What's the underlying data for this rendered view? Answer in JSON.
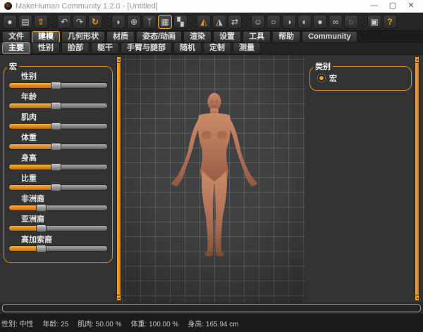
{
  "window": {
    "title": "MakeHuman Community 1.2.0 - [Untitled]",
    "controls": {
      "minimize": "—",
      "maximize": "▢",
      "close": "✕"
    }
  },
  "toolbar": {
    "buttons": [
      {
        "name": "new-human-icon",
        "glyph": "●"
      },
      {
        "name": "load-file-icon",
        "glyph": "▤"
      },
      {
        "name": "save-file-icon",
        "glyph": "⇧",
        "accent": true
      },
      {
        "sep": true
      },
      {
        "name": "undo-icon",
        "glyph": "↶"
      },
      {
        "name": "redo-icon",
        "glyph": "↷"
      },
      {
        "name": "reset-camera-icon",
        "glyph": "↻",
        "accent": true
      },
      {
        "sep": true
      },
      {
        "name": "smooth-shading-icon",
        "glyph": "◗"
      },
      {
        "name": "wireframe-icon",
        "glyph": "⊕"
      },
      {
        "name": "skeleton-icon",
        "glyph": "ᛉ"
      },
      {
        "name": "grid-toggle-icon",
        "glyph": "▦",
        "active": true
      },
      {
        "name": "texture-icon",
        "glyph": "▚"
      },
      {
        "sep": true
      },
      {
        "name": "symmetry-left-icon",
        "glyph": "◭",
        "accent": true
      },
      {
        "name": "symmetry-right-icon",
        "glyph": "◮"
      },
      {
        "name": "symmetry-both-icon",
        "glyph": "⇄"
      },
      {
        "sep": true
      },
      {
        "name": "face-view-icon",
        "glyph": "☺"
      },
      {
        "name": "head-front-view-icon",
        "glyph": "○"
      },
      {
        "name": "head-right-view-icon",
        "glyph": "◑"
      },
      {
        "name": "head-left-view-icon",
        "glyph": "◐"
      },
      {
        "name": "globe-view-icon",
        "glyph": "●"
      },
      {
        "name": "dual-view-icon",
        "glyph": "∞"
      },
      {
        "name": "orbit-view-icon",
        "glyph": "◌"
      },
      {
        "sep": true
      },
      {
        "name": "grab-screenshot-icon",
        "glyph": "▣"
      },
      {
        "name": "help-icon",
        "glyph": "?",
        "accent": true
      }
    ]
  },
  "menu_tabs": {
    "items": [
      {
        "label": "文件"
      },
      {
        "label": "建模",
        "active": true
      },
      {
        "label": "几何形状"
      },
      {
        "label": "材质"
      },
      {
        "label": "姿态/动画"
      },
      {
        "label": "渲染"
      },
      {
        "label": "设置"
      },
      {
        "label": "工具"
      },
      {
        "label": "帮助"
      },
      {
        "label": "Community"
      }
    ]
  },
  "sub_tabs": {
    "items": [
      {
        "label": "主要",
        "active": true
      },
      {
        "label": "性别"
      },
      {
        "label": "脸部"
      },
      {
        "label": "躯干"
      },
      {
        "label": "手臂与腿部"
      },
      {
        "label": "随机"
      },
      {
        "label": "定制"
      },
      {
        "label": "测量"
      }
    ]
  },
  "left_panel": {
    "group_label": "宏",
    "sliders": [
      {
        "label": "性别",
        "percent": 45
      },
      {
        "label": "年龄",
        "percent": 45
      },
      {
        "label": "肌肉",
        "percent": 45
      },
      {
        "label": "体重",
        "percent": 45
      },
      {
        "label": "身高",
        "percent": 45
      },
      {
        "label": "比重",
        "percent": 45
      },
      {
        "label": "非洲裔",
        "percent": 30
      },
      {
        "label": "亚洲裔",
        "percent": 30
      },
      {
        "label": "高加索裔",
        "percent": 30
      }
    ]
  },
  "right_panel": {
    "group_label": "类别",
    "options": [
      {
        "label": "宏",
        "selected": true
      }
    ]
  },
  "status_bar": {
    "segments": [
      {
        "label": "性别",
        "value": "中性"
      },
      {
        "label": "年龄",
        "value": "25"
      },
      {
        "label": "肌肉",
        "value": "50.00 %"
      },
      {
        "label": "体重",
        "value": "100.00 %"
      },
      {
        "label": "身高",
        "value": "165.94 cm"
      }
    ]
  },
  "colors": {
    "accent": "#e8952f",
    "panel_bg": "#333333",
    "viewport_bg": "#3f4143",
    "skin": "#b5765a"
  }
}
